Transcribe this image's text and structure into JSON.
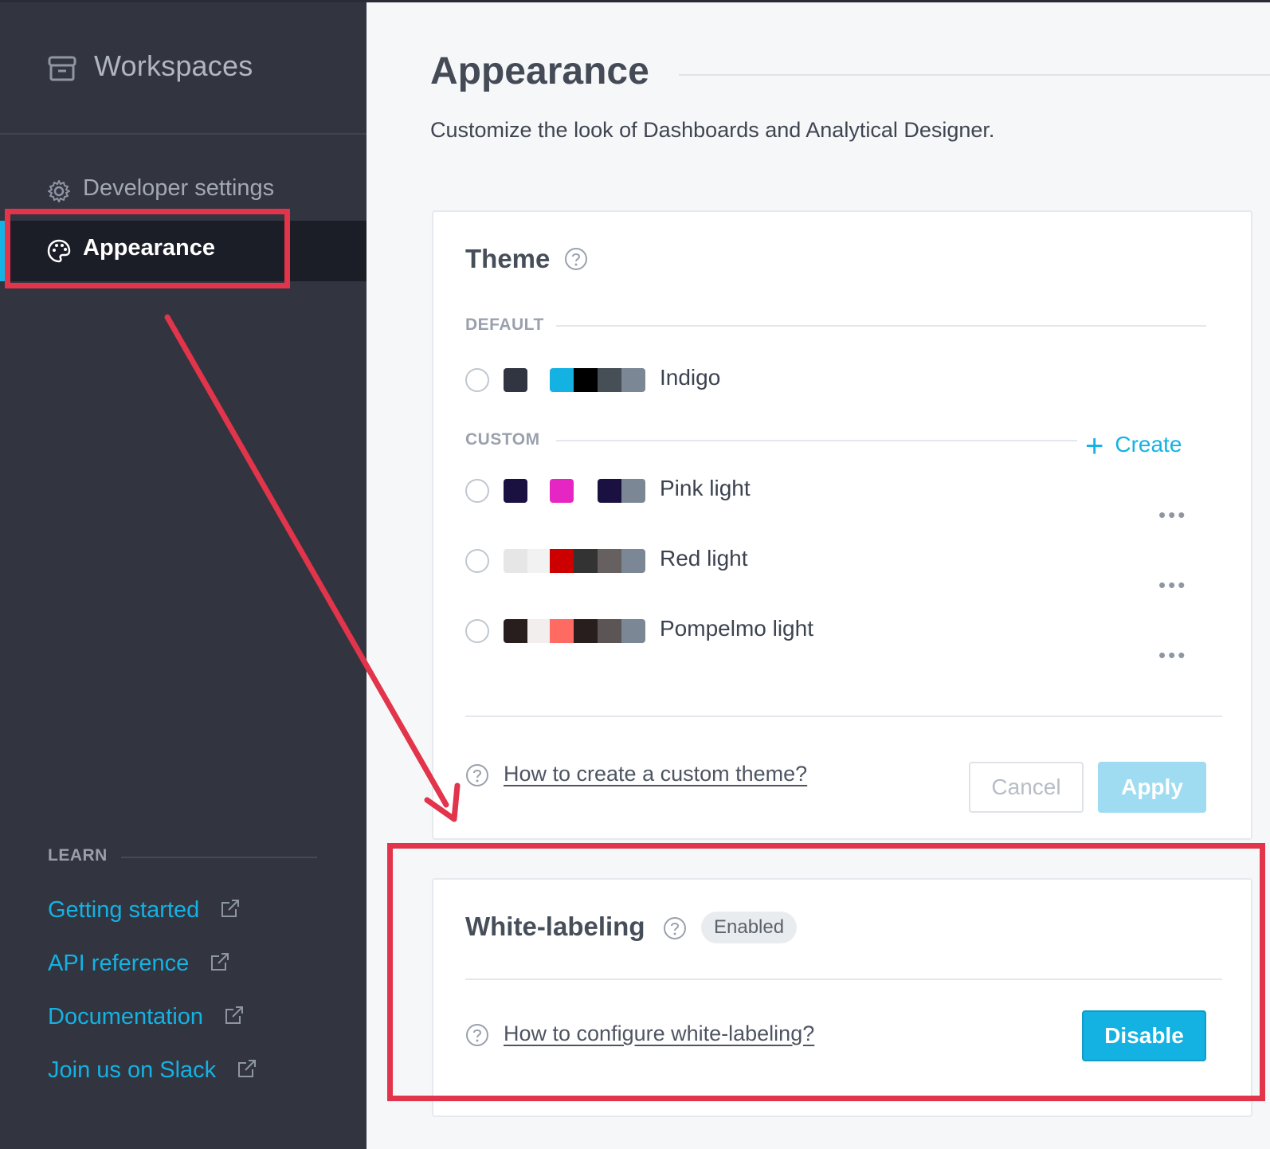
{
  "sidebar": {
    "workspaces_label": "Workspaces",
    "items": [
      {
        "label": "Developer settings",
        "icon": "gear-icon"
      },
      {
        "label": "Appearance",
        "icon": "palette-icon",
        "active": true
      }
    ],
    "learn": {
      "heading": "LEARN",
      "links": [
        {
          "label": "Getting started"
        },
        {
          "label": "API reference"
        },
        {
          "label": "Documentation"
        },
        {
          "label": "Join us on Slack"
        }
      ]
    }
  },
  "main": {
    "title": "Appearance",
    "subtitle": "Customize the look of Dashboards and Analytical Designer."
  },
  "theme_card": {
    "title": "Theme",
    "default_label": "DEFAULT",
    "custom_label": "CUSTOM",
    "create_label": "Create",
    "themes": [
      {
        "name": "Indigo",
        "group": "default",
        "primary": "#313441",
        "palette": [
          "#14b2e2",
          "#000000",
          "#464e56",
          "#7b8794"
        ]
      },
      {
        "name": "Pink light",
        "group": "custom",
        "primary": "#1b1141",
        "palette": [
          "#e626c3",
          "#ffffff",
          "#1b1141",
          "#7b8794"
        ]
      },
      {
        "name": "Red light",
        "group": "custom",
        "primary": "#e6e6e6",
        "palette": [
          "#f2f2f2",
          "#cc0000",
          "#333333",
          "#666060",
          "#7b8794"
        ]
      },
      {
        "name": "Pompelmo light",
        "group": "custom",
        "primary": "#291e1e",
        "palette": [
          "#f2eeee",
          "#ff6b63",
          "#291e1e",
          "#5c5555",
          "#7b8794"
        ]
      }
    ],
    "help_link": "How to create a custom theme?",
    "cancel_label": "Cancel",
    "apply_label": "Apply"
  },
  "white_label_card": {
    "title": "White-labeling",
    "badge": "Enabled",
    "help_link": "How to configure white-labeling?",
    "disable_label": "Disable"
  },
  "colors": {
    "accent": "#14b2e2",
    "sidebar_bg": "#323440",
    "annotation": "#e2344a"
  }
}
